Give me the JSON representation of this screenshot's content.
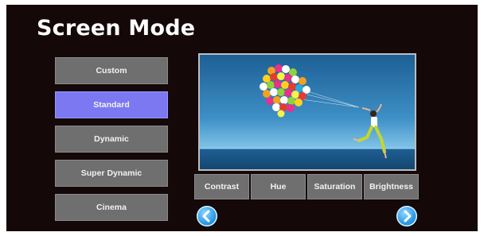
{
  "title": "Screen Mode",
  "modes": [
    {
      "label": "Custom",
      "selected": false
    },
    {
      "label": "Standard",
      "selected": true
    },
    {
      "label": "Dynamic",
      "selected": false
    },
    {
      "label": "Super Dynamic",
      "selected": false
    },
    {
      "label": "Cinema",
      "selected": false
    }
  ],
  "adjustments": [
    {
      "label": "Contrast"
    },
    {
      "label": "Hue"
    },
    {
      "label": "Saturation"
    },
    {
      "label": "Brightness"
    }
  ],
  "navigation": {
    "prev_icon": "chevron-left-icon",
    "next_icon": "chevron-right-icon"
  },
  "preview_image": {
    "content": "woman-with-balloons-at-sea"
  },
  "colors": {
    "background": "#140808",
    "button": "#6f6f6f",
    "selected": "#7b78f2",
    "arrow": "#2e9ae6"
  }
}
